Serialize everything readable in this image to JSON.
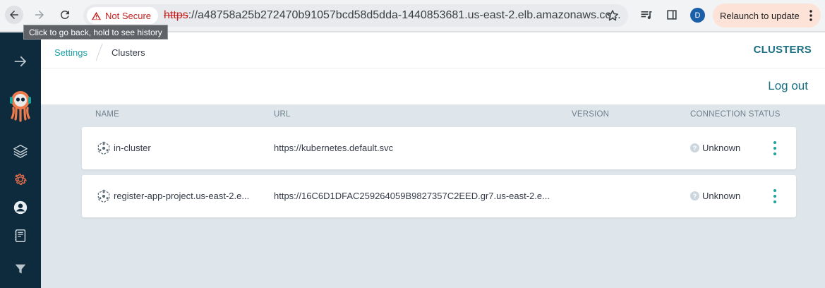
{
  "browser": {
    "security_label": "Not Secure",
    "url_scheme": "https",
    "url_rest": "://a48758a25b272470b91057bcd58d5dda-1440853681.us-east-2.elb.amazonaws.co...",
    "profile_initial": "D",
    "relaunch_label": "Relaunch to update",
    "tooltip": "Click to go back, hold to see history"
  },
  "breadcrumb": {
    "parent": "Settings",
    "current": "Clusters"
  },
  "header": {
    "title": "CLUSTERS",
    "logout": "Log out"
  },
  "table": {
    "columns": [
      "NAME",
      "URL",
      "VERSION",
      "CONNECTION STATUS"
    ],
    "rows": [
      {
        "name": "in-cluster",
        "url": "https://kubernetes.default.svc",
        "version": "",
        "status": "Unknown"
      },
      {
        "name": "register-app-project.us-east-2.e...",
        "url": "https://16C6D1DFAC259264059B9827357C2EED.gr7.us-east-2.e...",
        "version": "",
        "status": "Unknown"
      }
    ]
  },
  "colors": {
    "sidebar": "#0e2b3d",
    "accent": "#1a6f83",
    "teal": "#18a69c",
    "settings_active": "#e96d4c"
  }
}
